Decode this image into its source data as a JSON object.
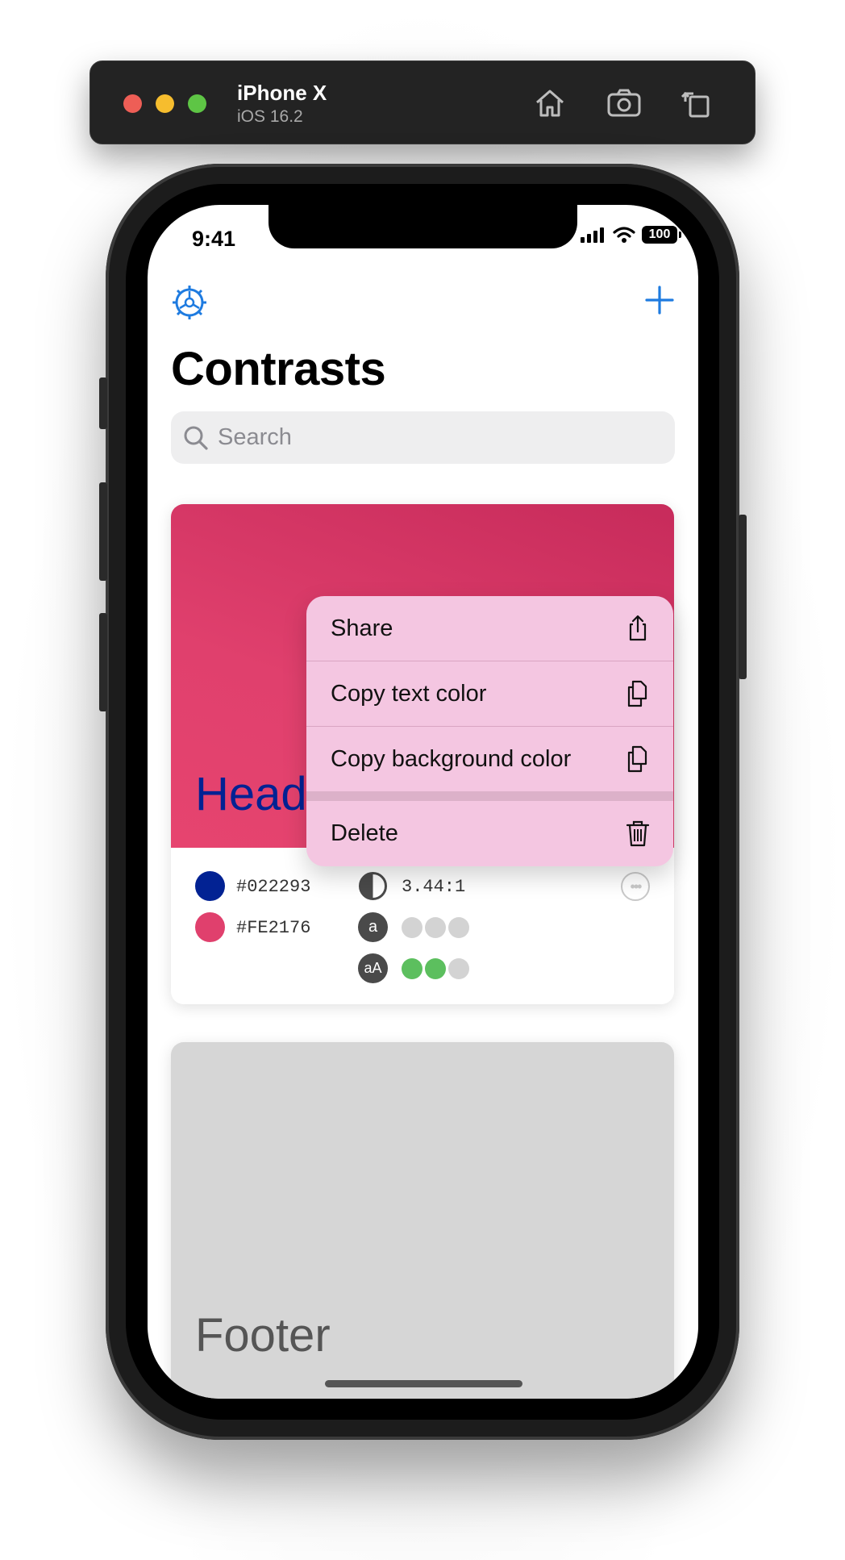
{
  "simulator": {
    "device_name": "iPhone X",
    "os_version": "iOS 16.2",
    "buttons": [
      "home-icon",
      "screenshot-icon",
      "rotate-icon"
    ]
  },
  "status_bar": {
    "time": "9:41",
    "battery": "100"
  },
  "nav": {
    "title": "Contrasts",
    "left_icon": "settings-gear-icon",
    "right_icon": "plus-icon"
  },
  "search": {
    "placeholder": "Search",
    "value": ""
  },
  "cards": [
    {
      "headline": "Head",
      "text_color": "#022293",
      "background_color": "#FE2176",
      "ratio": "3.44:1",
      "small_text_label": "a",
      "large_text_label": "aA",
      "small_text_passes": [
        false,
        false,
        false
      ],
      "large_text_passes": [
        true,
        true,
        false
      ]
    },
    {
      "headline": "Footer"
    }
  ],
  "context_menu": {
    "items": [
      {
        "label": "Share",
        "icon": "share-icon"
      },
      {
        "label": "Copy text color",
        "icon": "copy-icon"
      },
      {
        "label": "Copy background color",
        "icon": "copy-icon"
      },
      {
        "label": "Delete",
        "icon": "trash-icon"
      }
    ]
  },
  "colors": {
    "accent": "#1E7BE0",
    "pass": "#5CBF5E",
    "fail": "#D3D3D3",
    "menu_bg": "#F4C6E1"
  }
}
